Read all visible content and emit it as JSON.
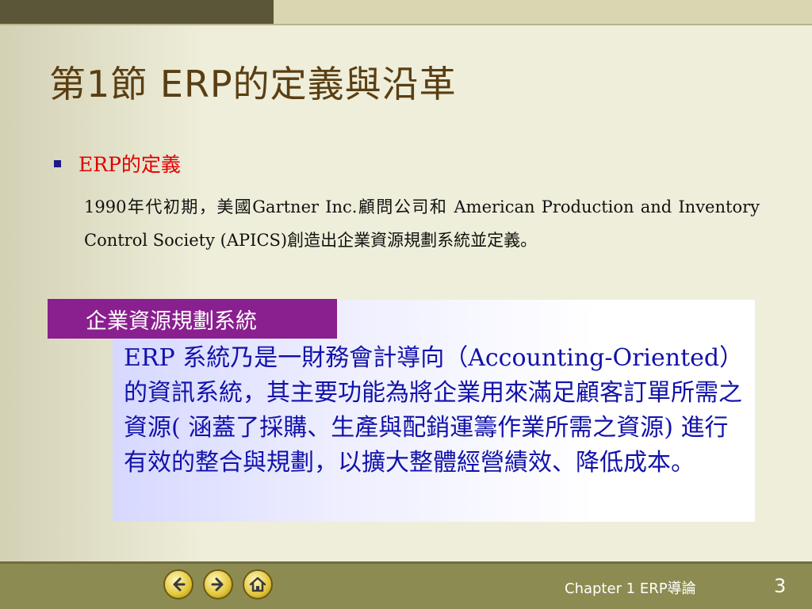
{
  "slide": {
    "title": "第1節  ERP的定義與沿革",
    "bullet": "ERP的定義",
    "paragraph": "1990年代初期，美國Gartner Inc.顧問公司和 American Production and Inventory Control Society (APICS)創造出企業資源規劃系統並定義。",
    "callout_tag": "企業資源規劃系統",
    "callout_text": "ERP 系統乃是一財務會計導向（Accounting-Oriented）的資訊系統，其主要功能為將企業用來滿足顧客訂單所需之資源( 涵蓋了採購、生產與配銷運籌作業所需之資源) 進行有效的整合與規劃，以擴大整體經營績效、降低成本。"
  },
  "footer": {
    "chapter": "Chapter 1    ERP導論",
    "page_number": "3",
    "nav": {
      "prev_icon": "arrow-left-icon",
      "next_icon": "arrow-right-icon",
      "home_icon": "home-icon"
    }
  },
  "colors": {
    "title": "#5a3e12",
    "bullet_text": "#e00000",
    "callout_tag_bg": "#8a1f8f",
    "callout_text": "#1212aa",
    "footer_bg": "#8c8c52"
  }
}
